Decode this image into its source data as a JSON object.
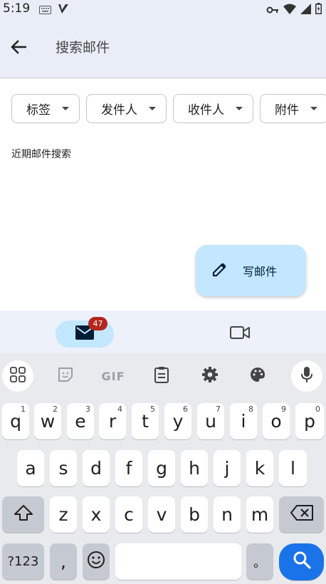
{
  "status_bar": {
    "time": "5:19"
  },
  "app_bar": {
    "search_placeholder": "搜索邮件"
  },
  "chips": [
    {
      "label": "标签"
    },
    {
      "label": "发件人"
    },
    {
      "label": "收件人"
    },
    {
      "label": "附件"
    }
  ],
  "recent_title": "近期邮件搜索",
  "compose": {
    "label": "写邮件"
  },
  "bottom_nav": {
    "mail_badge": "47"
  },
  "keyboard": {
    "toolbar": [
      "apps-icon",
      "sticker-icon",
      "gif-icon",
      "clipboard-icon",
      "settings-icon",
      "palette-icon",
      "mic-icon"
    ],
    "gif_label": "GIF",
    "row1": [
      {
        "key": "q",
        "hint": "1"
      },
      {
        "key": "w",
        "hint": "2"
      },
      {
        "key": "e",
        "hint": "3"
      },
      {
        "key": "r",
        "hint": "4"
      },
      {
        "key": "t",
        "hint": "5"
      },
      {
        "key": "y",
        "hint": "6"
      },
      {
        "key": "u",
        "hint": "7"
      },
      {
        "key": "i",
        "hint": "8"
      },
      {
        "key": "o",
        "hint": "9"
      },
      {
        "key": "p",
        "hint": "0"
      }
    ],
    "row2": [
      "a",
      "s",
      "d",
      "f",
      "g",
      "h",
      "j",
      "k",
      "l"
    ],
    "row3": [
      "z",
      "x",
      "c",
      "v",
      "b",
      "n",
      "m"
    ],
    "symbols_key": "?123",
    "comma_key": ",",
    "period_key": "。"
  },
  "colors": {
    "accent": "#1a73e8",
    "fab": "#c2e7ff",
    "badge": "#b3261e",
    "app_bar": "#e9edf7"
  }
}
